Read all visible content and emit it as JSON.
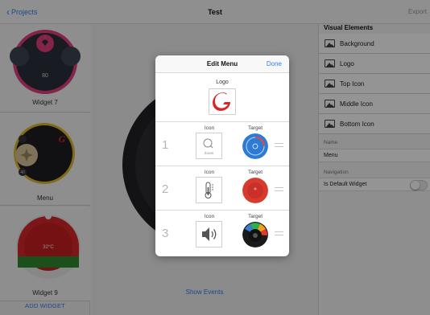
{
  "nav": {
    "back_label": "Projects",
    "title": "Test",
    "export_label": "Export"
  },
  "sidebar": {
    "widgets": [
      {
        "caption": "Widget 7",
        "value": "80"
      },
      {
        "caption": "Menu",
        "value": "40"
      },
      {
        "caption": "Widget 9",
        "value": "32°C"
      }
    ],
    "add_widget_label": "ADD WIDGET"
  },
  "canvas": {
    "show_events_label": "Show Events"
  },
  "inspector": {
    "visual_title": "Visual Elements",
    "visual_items": [
      "Background",
      "Logo",
      "Top Icon",
      "Middle Icon",
      "Bottom Icon"
    ],
    "name_caption": "Name",
    "name_value": "Menu",
    "navigation_caption": "Navigation",
    "default_widget_label": "Is Default Widget",
    "default_widget_on": false
  },
  "modal": {
    "title": "Edit Menu",
    "done_label": "Done",
    "logo_caption": "Logo",
    "rows": [
      {
        "number": "1",
        "icon_caption": "Icon",
        "target_caption": "Target",
        "icon": "zoom-icon",
        "icon_text": "Zoom",
        "target": "blue-dial"
      },
      {
        "number": "2",
        "icon_caption": "Icon",
        "target_caption": "Target",
        "icon": "thermometer-icon",
        "target": "red-dial"
      },
      {
        "number": "3",
        "icon_caption": "Icon",
        "target_caption": "Target",
        "icon": "speaker-icon",
        "target": "volume-dial"
      }
    ]
  },
  "colors": {
    "accent": "#2f7cf6",
    "logo_red": "#d7262b",
    "widget_pink": "#e23e7c",
    "widget_yellow": "#e0b92a"
  }
}
